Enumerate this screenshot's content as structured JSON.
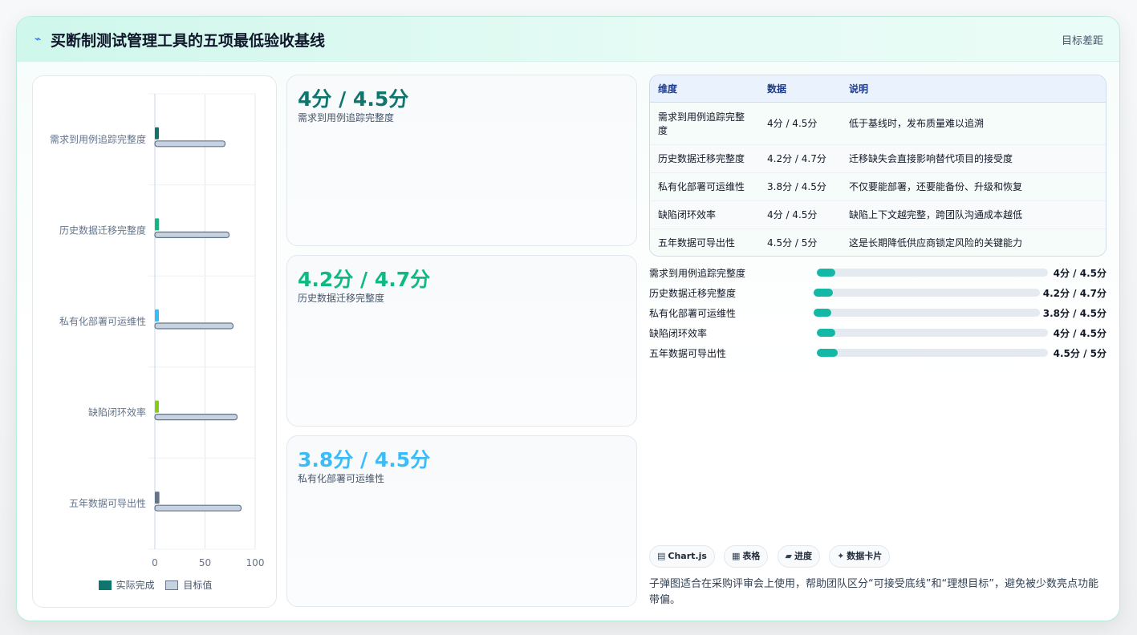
{
  "header": {
    "icon": "lightning-icon",
    "title": "买断制测试管理工具的五项最低验收基线",
    "tag": "目标差距"
  },
  "chart_data": {
    "type": "bar",
    "orientation": "horizontal",
    "categories": [
      "需求到用例追踪完整度",
      "历史数据迁移完整度",
      "私有化部署可运维性",
      "缺陷闭环效率",
      "五年数据可导出性"
    ],
    "series": [
      {
        "name": "实际完成",
        "values": [
          4,
          4.2,
          3.8,
          4,
          4.5
        ],
        "colors": [
          "#0f766e",
          "#10b981",
          "#38bdf8",
          "#84cc16",
          "#64748b"
        ]
      },
      {
        "name": "目标值",
        "values": [
          70,
          74,
          78,
          82,
          86
        ],
        "color": "#c7d2e0"
      }
    ],
    "xlim": [
      0,
      100
    ],
    "xticks": [
      "0",
      "50",
      "100"
    ],
    "grid": true,
    "legend": "bottom"
  },
  "stats": [
    {
      "value": "4分 / 4.5分",
      "label": "需求到用例追踪完整度",
      "color": "#0f766e"
    },
    {
      "value": "4.2分 / 4.7分",
      "label": "历史数据迁移完整度",
      "color": "#10b981"
    },
    {
      "value": "3.8分 / 4.5分",
      "label": "私有化部署可运维性",
      "color": "#38bdf8"
    }
  ],
  "table": {
    "headers": [
      "维度",
      "数据",
      "说明"
    ],
    "rows": [
      [
        "需求到用例追踪完整度",
        "4分 / 4.5分",
        "低于基线时，发布质量难以追溯"
      ],
      [
        "历史数据迁移完整度",
        "4.2分 / 4.7分",
        "迁移缺失会直接影响替代项目的接受度"
      ],
      [
        "私有化部署可运维性",
        "3.8分 / 4.5分",
        "不仅要能部署，还要能备份、升级和恢复"
      ],
      [
        "缺陷闭环效率",
        "4分 / 4.5分",
        "缺陷上下文越完整，跨团队沟通成本越低"
      ],
      [
        "五年数据可导出性",
        "4.5分 / 5分",
        "这是长期降低供应商锁定风险的关键能力"
      ]
    ]
  },
  "progress": [
    {
      "label": "需求到用例追踪完整度",
      "value": "4分 / 4.5分",
      "fraction": 0.04
    },
    {
      "label": "历史数据迁移完整度",
      "value": "4.2分 / 4.7分",
      "fraction": 0.042
    },
    {
      "label": "私有化部署可运维性",
      "value": "3.8分 / 4.5分",
      "fraction": 0.038
    },
    {
      "label": "缺陷闭环效率",
      "value": "4分 / 4.5分",
      "fraction": 0.04
    },
    {
      "label": "五年数据可导出性",
      "value": "4.5分 / 5分",
      "fraction": 0.045
    }
  ],
  "chips": [
    {
      "icon": "chart-icon",
      "glyph": "▤",
      "label": "Chart.js"
    },
    {
      "icon": "table-icon",
      "glyph": "▦",
      "label": "表格"
    },
    {
      "icon": "progress-icon",
      "glyph": "▰",
      "label": "进度"
    },
    {
      "icon": "sparkle-icon",
      "glyph": "✦",
      "label": "数据卡片"
    }
  ],
  "note": "子弹图适合在采购评审会上使用，帮助团队区分“可接受底线”和“理想目标”，避免被少数亮点功能带偏。"
}
